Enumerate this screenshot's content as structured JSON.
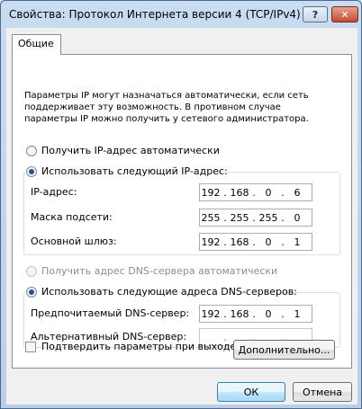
{
  "window": {
    "title": "Свойства: Протокол Интернета версии 4 (TCP/IPv4)",
    "help_label": "?",
    "close_label": "✕"
  },
  "tabs": [
    {
      "label": "Общие"
    }
  ],
  "info_text": "Параметры IP могут назначаться автоматически, если сеть поддерживает эту возможность. В противном случае параметры IP можно получить у сетевого администратора.",
  "ip_section": {
    "auto_label": "Получить IP-адрес автоматически",
    "manual_label": "Использовать следующий IP-адрес:",
    "selected": "manual",
    "fields": [
      {
        "label": "IP-адрес:",
        "octets": [
          "192",
          "168",
          "0",
          "6"
        ]
      },
      {
        "label": "Маска подсети:",
        "octets": [
          "255",
          "255",
          "255",
          "0"
        ]
      },
      {
        "label": "Основной шлюз:",
        "octets": [
          "192",
          "168",
          "0",
          "1"
        ]
      }
    ]
  },
  "dns_section": {
    "auto_label": "Получить адрес DNS-сервера автоматически",
    "manual_label": "Использовать следующие адреса DNS-серверов:",
    "selected": "manual",
    "fields": [
      {
        "label": "Предпочитаемый DNS-сервер:",
        "octets": [
          "192",
          "168",
          "0",
          "1"
        ]
      },
      {
        "label": "Альтернативный DNS-сервер:",
        "octets": [
          "",
          "",
          "",
          ""
        ]
      }
    ]
  },
  "validate_label": "Подтвердить параметры при выходе",
  "validate_checked": false,
  "advanced_label": "Дополнительно...",
  "ok_label": "ОК",
  "cancel_label": "Отмена"
}
